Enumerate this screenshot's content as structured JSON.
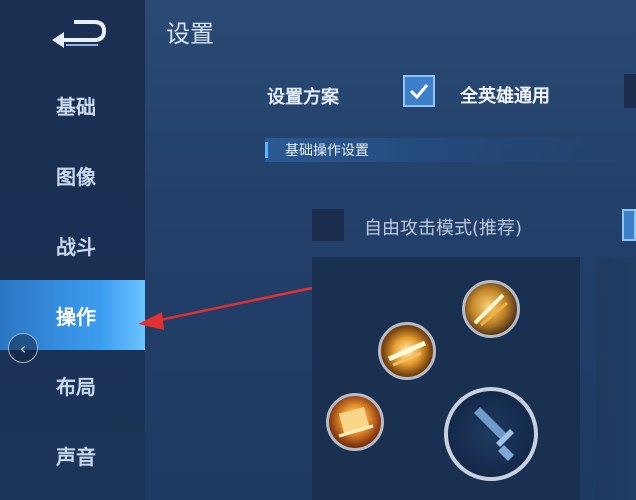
{
  "title": "设置",
  "sidebar": {
    "items": [
      {
        "label": "基础"
      },
      {
        "label": "图像"
      },
      {
        "label": "战斗"
      },
      {
        "label": "操作",
        "active": true
      },
      {
        "label": "布局"
      },
      {
        "label": "声音"
      }
    ]
  },
  "scheme": {
    "label": "设置方案",
    "value": "全英雄通用",
    "checked": true
  },
  "section": {
    "title": "基础操作设置"
  },
  "attack_mode": {
    "label": "自由攻击模式(推荐)",
    "checked": false
  },
  "colors": {
    "accent": "#3d9df0",
    "arrow": "#e03030",
    "background": "#22406a"
  },
  "icons": [
    "back-arrow-icon",
    "chevron-left-icon",
    "check-icon",
    "skill-icon",
    "sword-icon"
  ]
}
